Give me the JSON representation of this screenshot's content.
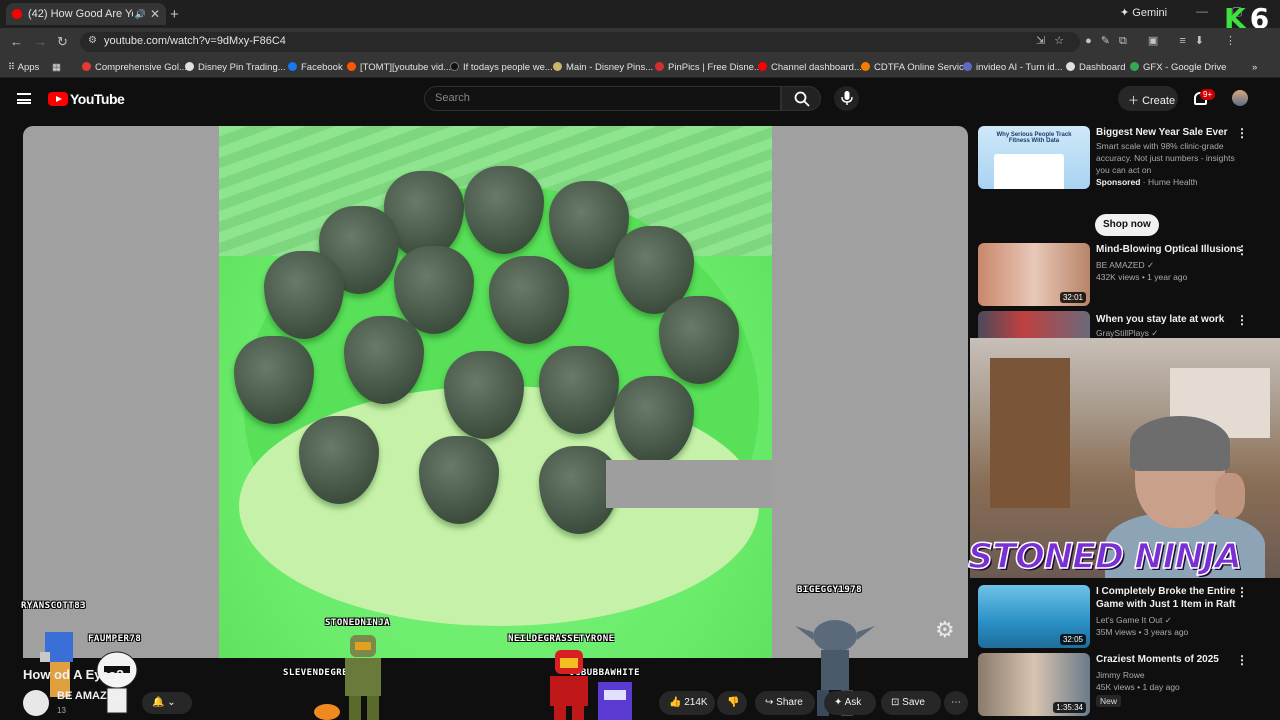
{
  "browser": {
    "tab_title": "(42) How Good Are Your Ey",
    "new_tab_icon": "plus-icon",
    "gemini_label": "Gemini",
    "url": "youtube.com/watch?v=9dMxy-F86C4",
    "bookmarks": [
      {
        "label": "Apps",
        "color": "#9a9a9a"
      },
      {
        "label": "Comprehensive Gol...",
        "color": "#e53935"
      },
      {
        "label": "Disney Pin Trading...",
        "color": "#e0e0e0"
      },
      {
        "label": "Facebook",
        "color": "#1877f2"
      },
      {
        "label": "[TOMT][youtube vid...",
        "color": "#ff5700"
      },
      {
        "label": "If todays people we...",
        "color": "#111111"
      },
      {
        "label": "Main - Disney Pins...",
        "color": "#c8b56b"
      },
      {
        "label": "PinPics | Free Disne...",
        "color": "#d32f2f"
      },
      {
        "label": "Channel dashboard...",
        "color": "#ff0000"
      },
      {
        "label": "CDTFA Online Servic...",
        "color": "#f57c00"
      },
      {
        "label": "invideo AI - Turn id...",
        "color": "#5c6bc0"
      },
      {
        "label": "Dashboard",
        "color": "#e0e0e0"
      },
      {
        "label": "GFX - Google Drive",
        "color": "#34a853"
      }
    ]
  },
  "overlay": {
    "k_label": "K",
    "k_number": "6",
    "banner": "STONED NINJA"
  },
  "youtube": {
    "logo_text": "YouTube",
    "search_placeholder": "Search",
    "create_label": "Create",
    "notif_badge": "9+"
  },
  "video": {
    "title": "How Good Are Your Eyes?",
    "title_visible": "How      od A          Eyes?",
    "channel": "BE AMAZED",
    "subs": "13",
    "like_count": "214K",
    "share_label": "Share",
    "ask_label": "Ask",
    "save_label": "Save"
  },
  "chat_names": [
    "RYANSCOTT83",
    "FAUMPER78",
    "STONEDNINJA",
    "NEILDEGRASSETYRONE",
    "BIGEGGY1978",
    "SLEVENDEGREE",
    "OGBUBBAWHITE"
  ],
  "sidebar": {
    "ad": {
      "title": "Biggest New Year Sale Ever",
      "desc": "Smart scale with 98% clinic-grade accuracy. Not just numbers - insights you can act on",
      "sponsored": "Sponsored",
      "advertiser": "Hume Health",
      "cta": "Shop now",
      "thumb_text": "Why Serious People Track Fitness With Data"
    },
    "videos": [
      {
        "title": "Mind-Blowing Optical Illusions",
        "channel": "BE AMAZED",
        "meta": "432K views • 1 year ago",
        "duration": "32:01"
      },
      {
        "title": "When you stay late at work",
        "channel": "GrayStillPlays",
        "meta": "",
        "duration": ""
      },
      {
        "title": "I Completely Broke the Entire Game with Just 1 Item in Raft",
        "channel": "Let's Game It Out",
        "meta": "35M views • 3 years ago",
        "duration": "32:05"
      },
      {
        "title": "Craziest Moments of 2025",
        "channel": "Jimmy Rowe",
        "meta": "45K views • 1 day ago",
        "badge": "New",
        "duration": "1:35:34"
      }
    ]
  }
}
